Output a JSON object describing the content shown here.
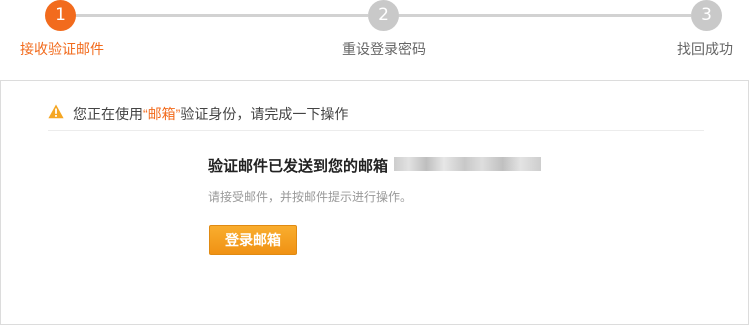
{
  "steps": [
    {
      "number": "1",
      "label": "接收验证邮件",
      "state": "active"
    },
    {
      "number": "2",
      "label": "重设登录密码",
      "state": "inactive"
    },
    {
      "number": "3",
      "label": "找回成功",
      "state": "inactive"
    }
  ],
  "notice": {
    "icon": "warning-icon",
    "prefix": "您正在使用",
    "highlight": "“邮箱”",
    "suffix": "验证身份，请完成一下操作"
  },
  "mail": {
    "title": "验证邮件已发送到您的邮箱",
    "hint": "请接受邮件，并按邮件提示进行操作。",
    "button_label": "登录邮箱"
  },
  "colors": {
    "accent": "#f26b1d",
    "inactive": "#c9c9c9",
    "button": "#f5a020"
  }
}
